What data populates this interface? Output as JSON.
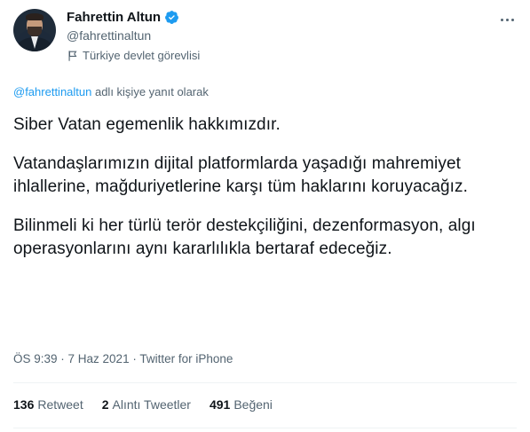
{
  "author": {
    "display_name": "Fahrettin Altun",
    "handle": "@fahrettinaltun",
    "verified": true,
    "label": "Türkiye devlet görevlisi",
    "label_icon": "flag-icon"
  },
  "reply": {
    "mention": "@fahrettinaltun",
    "suffix": " adlı kişiye yanıt olarak"
  },
  "tweet": {
    "paragraphs": [
      "Siber Vatan egemenlik hakkımızdır.",
      "Vatandaşlarımızın dijital platformlarda yaşadığı mahremiyet ihlallerine, mağduriyetlerine karşı tüm haklarını koruyacağız.",
      "Bilinmeli ki her türlü terör destekçiliğini, dezenformasyon, algı operasyonlarını aynı kararlılıkla bertaraf edeceğiz."
    ],
    "timestamp": "ÖS 9:39 · 7 Haz 2021 · Twitter for iPhone"
  },
  "stats": {
    "retweets_count": "136",
    "retweets_label": "Retweet",
    "quotes_count": "2",
    "quotes_label": "Alıntı Tweetler",
    "likes_count": "491",
    "likes_label": "Beğeni"
  },
  "colors": {
    "accent": "#1d9bf0",
    "secondary_text": "#536471",
    "primary_text": "#0f1419"
  }
}
